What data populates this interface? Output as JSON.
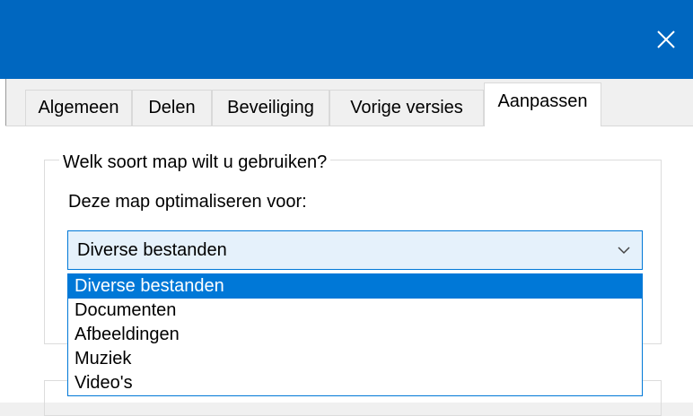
{
  "window": {
    "close_icon": "close-icon"
  },
  "tabs": [
    {
      "label": "Algemeen"
    },
    {
      "label": "Delen"
    },
    {
      "label": "Beveiliging"
    },
    {
      "label": "Vorige versies"
    },
    {
      "label": "Aanpassen",
      "active": true
    }
  ],
  "group": {
    "legend": "Welk soort map wilt u gebruiken?",
    "optimize_label": "Deze map optimaliseren voor:"
  },
  "combo": {
    "value": "Diverse bestanden",
    "arrow_icon": "chevron-down-icon"
  },
  "dropdown": {
    "options": [
      {
        "label": "Diverse bestanden",
        "selected": true
      },
      {
        "label": "Documenten"
      },
      {
        "label": "Afbeeldingen"
      },
      {
        "label": "Muziek"
      },
      {
        "label": "Video's"
      }
    ]
  },
  "colors": {
    "titlebar": "#0067c0",
    "selection": "#0078d7",
    "combo_bg": "#e5f1fb",
    "dialog_bg": "#f0f0f0"
  }
}
